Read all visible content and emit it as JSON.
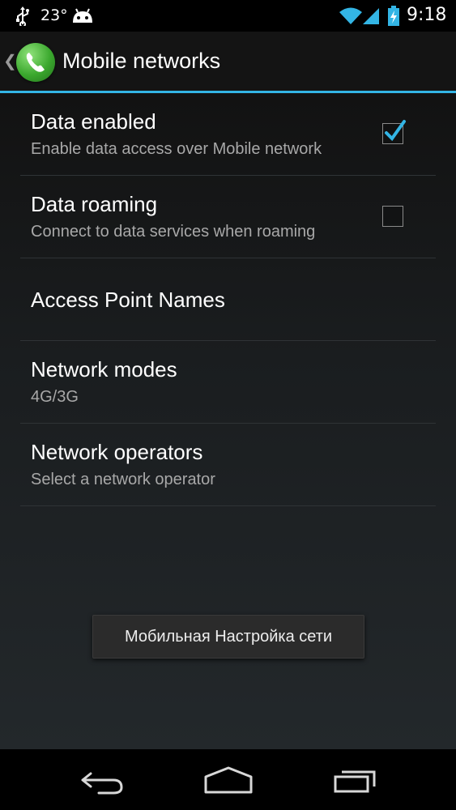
{
  "status_bar": {
    "temperature": "23°",
    "time": "9:18",
    "icons": [
      "usb-icon",
      "android-icon",
      "wifi-icon",
      "signal-icon",
      "battery-charging-icon"
    ],
    "accent_color": "#33b5e5"
  },
  "action_bar": {
    "title": "Mobile networks",
    "app_icon": "phone-icon",
    "accent_color": "#33b5e5"
  },
  "preferences": [
    {
      "title": "Data enabled",
      "summary": "Enable data access over Mobile network",
      "checked": true
    },
    {
      "title": "Data roaming",
      "summary": "Connect to data services when roaming",
      "checked": false
    },
    {
      "title": "Access Point Names",
      "summary": ""
    },
    {
      "title": "Network modes",
      "summary": "4G/3G"
    },
    {
      "title": "Network operators",
      "summary": "Select a network operator"
    }
  ],
  "toast": {
    "text": "Мобильная Настройка сети"
  },
  "nav_bar": {
    "buttons": [
      "back-icon",
      "home-icon",
      "recent-apps-icon"
    ]
  }
}
